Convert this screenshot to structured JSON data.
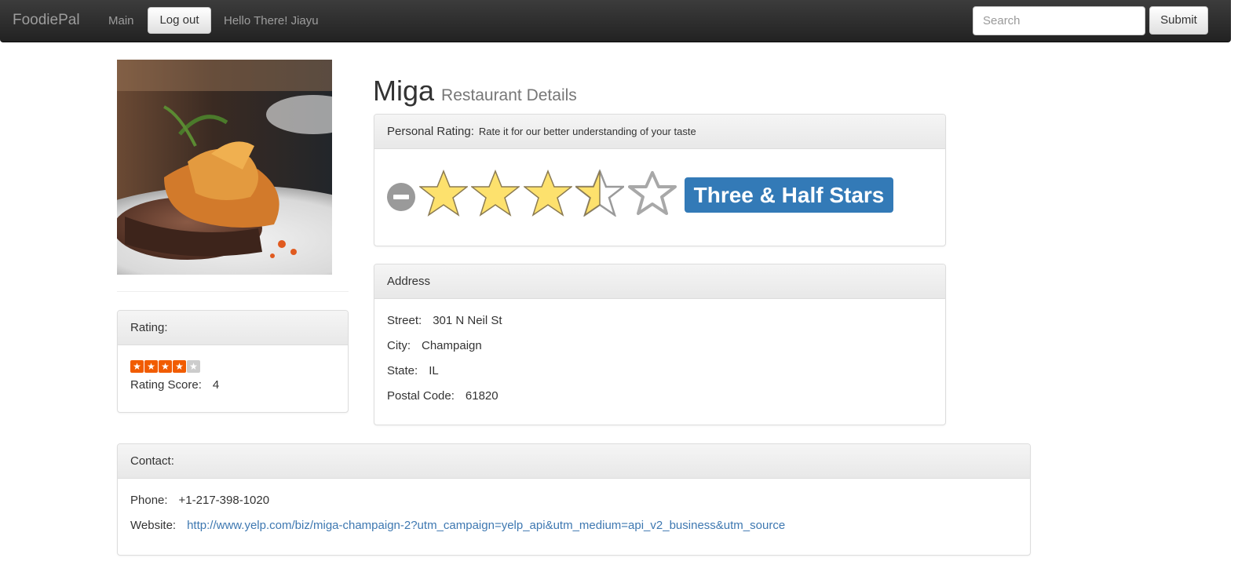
{
  "navbar": {
    "brand": "FoodiePal",
    "main_link": "Main",
    "logout_label": "Log out",
    "greeting": "Hello There! Jiayu",
    "search_placeholder": "Search",
    "submit_label": "Submit"
  },
  "restaurant": {
    "name": "Miga",
    "subtitle": "Restaurant Details"
  },
  "rating_panel": {
    "heading": "Rating:",
    "stars": 4,
    "stars_max": 5,
    "score_label": "Rating Score:",
    "score_value": "4"
  },
  "personal_rating": {
    "heading": "Personal Rating:",
    "hint": "Rate it for our better understanding of your taste",
    "value": 3.5,
    "max": 5,
    "badge": "Three & Half Stars",
    "star_color": "#fde16d",
    "badge_color": "#337ab7"
  },
  "address": {
    "heading": "Address",
    "street_label": "Street:",
    "street": "301 N Neil St",
    "city_label": "City:",
    "city": "Champaign",
    "state_label": "State:",
    "state": "IL",
    "postal_label": "Postal Code:",
    "postal": "61820"
  },
  "contact": {
    "heading": "Contact:",
    "phone_label": "Phone:",
    "phone": "+1-217-398-1020",
    "website_label": "Website:",
    "website": "http://www.yelp.com/biz/miga-champaign-2?utm_campaign=yelp_api&utm_medium=api_v2_business&utm_source"
  },
  "colors": {
    "navbar": "#222222",
    "link": "#3e78b1",
    "mini_star": "#f15c00"
  }
}
